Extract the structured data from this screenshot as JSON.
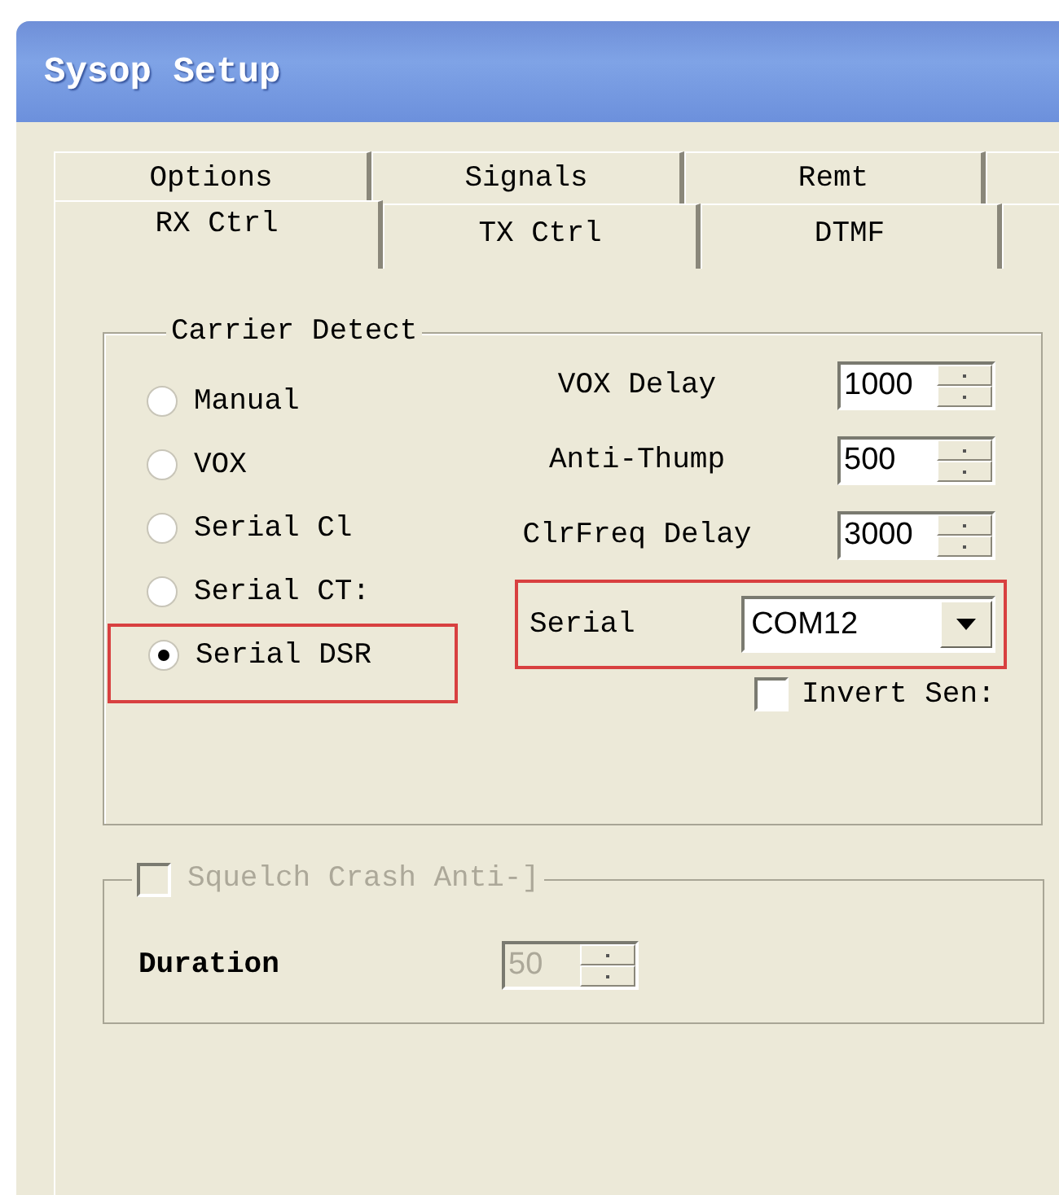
{
  "window": {
    "title": "Sysop Setup"
  },
  "tabs": {
    "rows": [
      [
        {
          "label": "Options",
          "selected": false
        },
        {
          "label": "Signals",
          "selected": false
        },
        {
          "label": "Remt",
          "selected": false
        }
      ],
      [
        {
          "label": "RX Ctrl",
          "selected": true
        },
        {
          "label": "TX Ctrl",
          "selected": false
        },
        {
          "label": "DTMF",
          "selected": false
        }
      ]
    ]
  },
  "carrier_detect": {
    "title": "Carrier Detect",
    "options": [
      {
        "label": "Manual",
        "selected": false,
        "highlighted": false
      },
      {
        "label": "VOX",
        "selected": false,
        "highlighted": false
      },
      {
        "label": "Serial Cl",
        "selected": false,
        "highlighted": false
      },
      {
        "label": "Serial CT:",
        "selected": false,
        "highlighted": false
      },
      {
        "label": "Serial DSR",
        "selected": true,
        "highlighted": true
      }
    ],
    "settings": [
      {
        "label": "VOX Delay",
        "value": "1000"
      },
      {
        "label": "Anti-Thump",
        "value": "500"
      },
      {
        "label": "ClrFreq Delay",
        "value": "3000"
      }
    ],
    "serial": {
      "label": "Serial",
      "value": "COM12",
      "highlighted": true
    },
    "invert": {
      "label": "Invert Sen:",
      "checked": false
    }
  },
  "squelch": {
    "label": "Squelch Crash Anti-]",
    "checked": false,
    "disabled": true,
    "duration": {
      "label": "Duration",
      "value": "50",
      "disabled": true
    }
  }
}
